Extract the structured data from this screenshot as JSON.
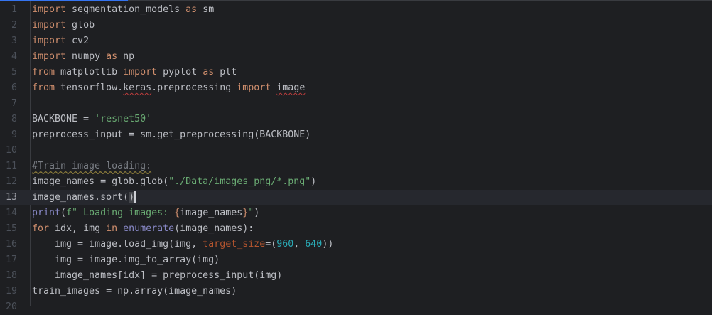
{
  "editor": {
    "current_line": 13,
    "lines": [
      {
        "n": "1",
        "tokens": [
          [
            "kw",
            "import"
          ],
          [
            "t",
            " segmentation_models "
          ],
          [
            "kw",
            "as"
          ],
          [
            "t",
            " sm"
          ]
        ]
      },
      {
        "n": "2",
        "tokens": [
          [
            "kw",
            "import"
          ],
          [
            "t",
            " glob"
          ]
        ]
      },
      {
        "n": "3",
        "tokens": [
          [
            "kw",
            "import"
          ],
          [
            "t",
            " cv2"
          ]
        ]
      },
      {
        "n": "4",
        "tokens": [
          [
            "kw",
            "import"
          ],
          [
            "t",
            " numpy "
          ],
          [
            "kw",
            "as"
          ],
          [
            "t",
            " np"
          ]
        ]
      },
      {
        "n": "5",
        "tokens": [
          [
            "kw",
            "from"
          ],
          [
            "t",
            " matplotlib "
          ],
          [
            "kw",
            "import"
          ],
          [
            "t",
            " pyplot "
          ],
          [
            "kw",
            "as"
          ],
          [
            "t",
            " plt"
          ]
        ]
      },
      {
        "n": "6",
        "tokens": [
          [
            "kw",
            "from"
          ],
          [
            "t",
            " tensorflow."
          ],
          [
            "typo",
            "keras"
          ],
          [
            "t",
            ".preprocessing "
          ],
          [
            "kw",
            "import"
          ],
          [
            "t",
            " "
          ],
          [
            "typo",
            "image"
          ]
        ]
      },
      {
        "n": "7",
        "tokens": []
      },
      {
        "n": "8",
        "tokens": [
          [
            "t",
            "BACKBONE = "
          ],
          [
            "str",
            "'resnet50'"
          ]
        ]
      },
      {
        "n": "9",
        "tokens": [
          [
            "t",
            "preprocess_input = sm.get_preprocessing(BACKBONE)"
          ]
        ]
      },
      {
        "n": "10",
        "tokens": []
      },
      {
        "n": "11",
        "tokens": [
          [
            "cm",
            "#Train image loading:"
          ]
        ]
      },
      {
        "n": "12",
        "tokens": [
          [
            "t",
            "image_names = glob.glob("
          ],
          [
            "str",
            "\"./Data/images_png/*.png\""
          ],
          [
            "t",
            ")"
          ]
        ]
      },
      {
        "n": "13",
        "tokens": [
          [
            "t",
            "image_names.sort("
          ],
          [
            "brace",
            ")"
          ],
          [
            "caret",
            ""
          ]
        ]
      },
      {
        "n": "14",
        "tokens": [
          [
            "bi",
            "print"
          ],
          [
            "t",
            "("
          ],
          [
            "str",
            "f\" Loading images: "
          ],
          [
            "kw",
            "{"
          ],
          [
            "t",
            "image_names"
          ],
          [
            "kw",
            "}"
          ],
          [
            "str",
            "\""
          ],
          [
            "t",
            ")"
          ]
        ]
      },
      {
        "n": "15",
        "tokens": [
          [
            "kw",
            "for"
          ],
          [
            "t",
            " idx, img "
          ],
          [
            "kw",
            "in"
          ],
          [
            "t",
            " "
          ],
          [
            "bi",
            "enumerate"
          ],
          [
            "t",
            "(image_names):"
          ]
        ]
      },
      {
        "n": "16",
        "tokens": [
          [
            "t",
            "    img = image.load_img(img, "
          ],
          [
            "par",
            "target_size"
          ],
          [
            "t",
            "=("
          ],
          [
            "num",
            "960"
          ],
          [
            "t",
            ", "
          ],
          [
            "num",
            "640"
          ],
          [
            "t",
            "))"
          ]
        ]
      },
      {
        "n": "17",
        "tokens": [
          [
            "t",
            "    img = image.img_to_array(img)"
          ]
        ]
      },
      {
        "n": "18",
        "tokens": [
          [
            "t",
            "    image_names[idx] = preprocess_input(img)"
          ]
        ]
      },
      {
        "n": "19",
        "tokens": [
          [
            "t",
            "train_images = np.array(image_names)"
          ]
        ]
      },
      {
        "n": "20",
        "tokens": []
      }
    ]
  }
}
